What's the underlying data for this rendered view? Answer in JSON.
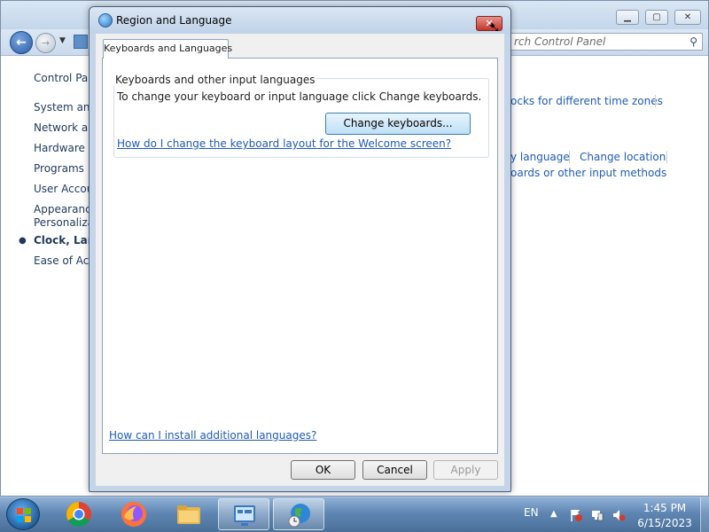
{
  "control_panel": {
    "search_placeholder": "Search Control Panel",
    "nav_items": [
      {
        "label": "Control Panel Home"
      },
      {
        "label": "System and Security"
      },
      {
        "label": "Network and Internet"
      },
      {
        "label": "Hardware and Sound"
      },
      {
        "label": "Programs"
      },
      {
        "label": "User Accounts"
      },
      {
        "label": "Appearance and Personalization"
      },
      {
        "label": "Clock, Language, and Region"
      },
      {
        "label": "Ease of Access"
      }
    ],
    "nav_visible": [
      "Control Panel",
      "System and",
      "Network and",
      "Hardware and",
      "Programs",
      "User Accoun",
      "Appearance",
      "Personalizati",
      "Clock, Langu",
      "Ease of Acce"
    ],
    "links": {
      "clocks": "ocks for different time zones",
      "display_language": "y language",
      "change_location": "Change location",
      "keyboards": "oards or other input methods"
    }
  },
  "dialog": {
    "title": "Region and Language",
    "tab": "Keyboards and Languages",
    "group_title": "Keyboards and other input languages",
    "group_description": "To change your keyboard or input language click Change keyboards.",
    "change_keyboards_label": "Change keyboards...",
    "welcome_link": "How do I change the keyboard layout for the Welcome screen?",
    "install_link": "How can I install additional languages?",
    "ok_label": "OK",
    "cancel_label": "Cancel",
    "apply_label": "Apply"
  },
  "taskbar": {
    "apps": [
      "start-menu",
      "chrome",
      "firefox",
      "file-explorer",
      "control-panel",
      "region-and-language"
    ],
    "language": "EN",
    "time": "1:45 PM",
    "date": "6/15/2023"
  }
}
